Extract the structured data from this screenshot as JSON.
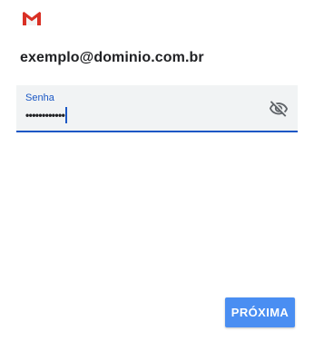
{
  "app": {
    "logo_icon": "gmail-logo-icon"
  },
  "account": {
    "email": "exemplo@dominio.com.br"
  },
  "password": {
    "label": "Senha",
    "masked_value": "••••••••••••",
    "toggle_icon": "visibility-off-icon"
  },
  "actions": {
    "next_label": "PRÓXIMA"
  },
  "colors": {
    "accent": "#1a57c5",
    "button": "#4a8ef2",
    "field_background": "#f1f3f4"
  }
}
